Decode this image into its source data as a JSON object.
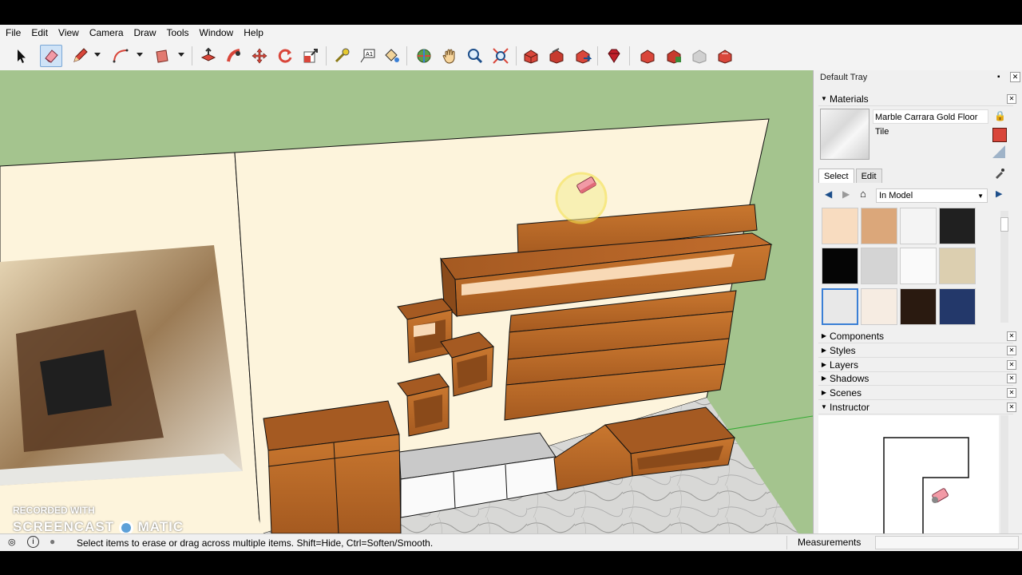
{
  "menu": [
    "File",
    "Edit",
    "View",
    "Camera",
    "Draw",
    "Tools",
    "Window",
    "Help"
  ],
  "toolbar_icons": [
    "select-arrow-icon",
    "eraser-icon",
    "pencil-icon",
    "arc-icon",
    "rectangle-icon",
    "push-pull-icon",
    "follow-me-icon",
    "move-icon",
    "rotate-icon",
    "scale-icon",
    "tape-measure-icon",
    "text-label-icon",
    "paint-bucket-icon",
    "orbit-icon",
    "pan-icon",
    "zoom-icon",
    "zoom-extents-icon",
    "warehouse-icon",
    "share-model-icon",
    "extension-warehouse-icon",
    "ruby-icon",
    "component-icon",
    "layout-icon",
    "send-to-layout-icon",
    "gem-icon"
  ],
  "tray": {
    "title": "Default Tray",
    "materials": {
      "header": "Materials",
      "current_material": "Marble Carrara Gold Floor Tile",
      "tab_select": "Select",
      "tab_edit": "Edit",
      "library": "In Model",
      "swatch_colors": [
        "#f8dcc0",
        "#dba77a",
        "#f4f4f4",
        "#202020",
        "#050505",
        "#d4d4d4",
        "#fafafa",
        "#dccfb0",
        "#e8e8e8",
        "#f6ece2",
        "#2a1a10",
        "#23386a"
      ],
      "selected_index": 8
    },
    "panels": [
      "Components",
      "Styles",
      "Layers",
      "Shadows",
      "Scenes"
    ],
    "instructor": "Instructor"
  },
  "status": {
    "text": "Select items to erase or drag across multiple items. Shift=Hide, Ctrl=Soften/Smooth.",
    "measurements_label": "Measurements"
  },
  "watermark": {
    "line1": "RECORDED WITH",
    "line2": "SCREENCAST",
    "line3": "MATIC"
  },
  "colors": {
    "sky": "#a4c48e",
    "wall": "#fdf4dc",
    "wood": "#b8652a",
    "wood_dark": "#8a4a1a",
    "cursor_highlight": "#f4e14a"
  }
}
